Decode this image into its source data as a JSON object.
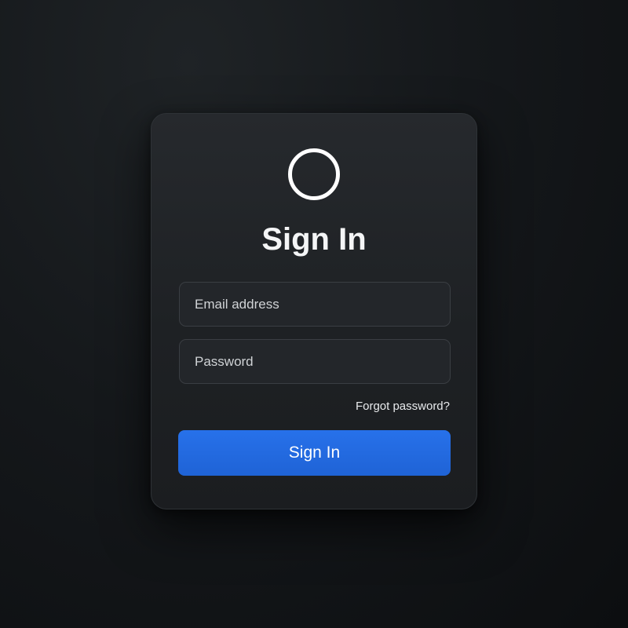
{
  "theme": {
    "accent": "#2468e0",
    "background": "#121417",
    "card": "#212427"
  },
  "logo": {
    "icon": "circle-logo-icon"
  },
  "title": "Sign In",
  "form": {
    "email": {
      "placeholder": "Email address",
      "value": ""
    },
    "password": {
      "placeholder": "Password",
      "value": ""
    },
    "forgot_label": "Forgot password?",
    "submit_label": "Sign In"
  }
}
